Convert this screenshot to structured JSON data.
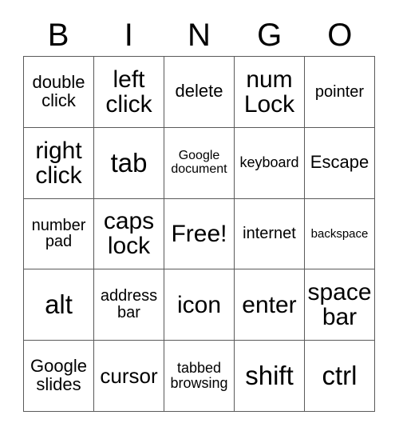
{
  "card": {
    "title_letters": [
      "B",
      "I",
      "N",
      "G",
      "O"
    ],
    "rows": [
      [
        {
          "text": "double\nclick",
          "size": "fs-ml"
        },
        {
          "text": "left\nclick",
          "size": "fs-xl"
        },
        {
          "text": "delete",
          "size": "fs-ml"
        },
        {
          "text": "num\nLock",
          "size": "fs-xl"
        },
        {
          "text": "pointer",
          "size": "fs-m"
        }
      ],
      [
        {
          "text": "right\nclick",
          "size": "fs-xl"
        },
        {
          "text": "tab",
          "size": "fs-xxl"
        },
        {
          "text": "Google\ndocument",
          "size": "fs-s"
        },
        {
          "text": "keyboard",
          "size": "fs-sm"
        },
        {
          "text": "Escape",
          "size": "fs-ml"
        }
      ],
      [
        {
          "text": "number\npad",
          "size": "fs-m"
        },
        {
          "text": "caps\nlock",
          "size": "fs-xl"
        },
        {
          "text": "Free!",
          "size": "fs-xl"
        },
        {
          "text": "internet",
          "size": "fs-m"
        },
        {
          "text": "backspace",
          "size": "fs-xs"
        }
      ],
      [
        {
          "text": "alt",
          "size": "fs-xxl"
        },
        {
          "text": "address\nbar",
          "size": "fs-m"
        },
        {
          "text": "icon",
          "size": "fs-xl"
        },
        {
          "text": "enter",
          "size": "fs-xl"
        },
        {
          "text": "space\nbar",
          "size": "fs-xl"
        }
      ],
      [
        {
          "text": "Google\nslides",
          "size": "fs-ml"
        },
        {
          "text": "cursor",
          "size": "fs-l"
        },
        {
          "text": "tabbed\nbrowsing",
          "size": "fs-sm"
        },
        {
          "text": "shift",
          "size": "fs-xxl"
        },
        {
          "text": "ctrl",
          "size": "fs-xxl"
        }
      ]
    ]
  },
  "colors": {
    "background": "#ffffff",
    "text": "#000000",
    "border": "#5a5a5a"
  }
}
